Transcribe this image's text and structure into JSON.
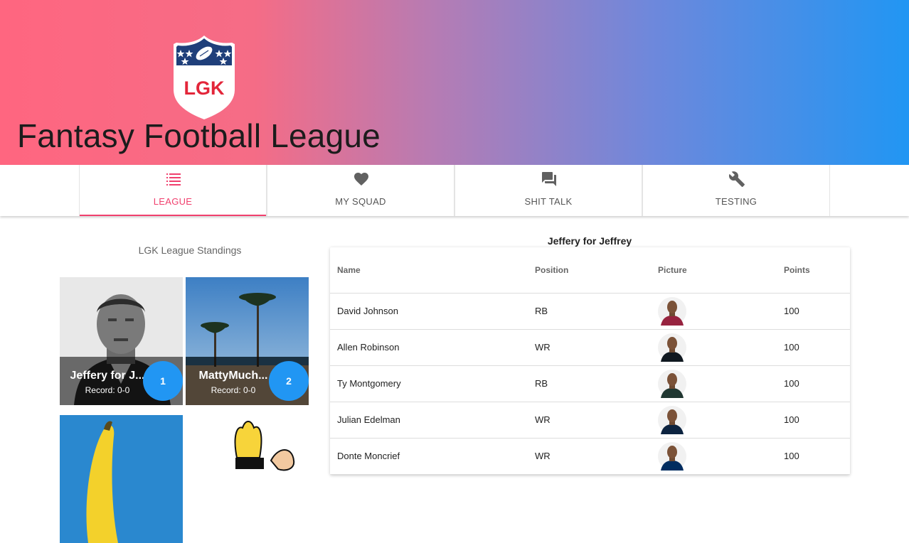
{
  "header": {
    "logo_text": "LGK",
    "title": "Fantasy Football League"
  },
  "tabs": [
    {
      "label": "LEAGUE",
      "icon": "list-icon",
      "active": true
    },
    {
      "label": "MY SQUAD",
      "icon": "heart-icon",
      "active": false
    },
    {
      "label": "SHIT TALK",
      "icon": "chat-icon",
      "active": false
    },
    {
      "label": "TESTING",
      "icon": "wrench-icon",
      "active": false
    }
  ],
  "standings": {
    "title": "LGK League Standings",
    "teams": [
      {
        "name": "Jeffery for J...",
        "record": "Record: 0-0",
        "rank": "1"
      },
      {
        "name": "MattyMuch...",
        "record": "Record: 0-0",
        "rank": "2"
      }
    ]
  },
  "roster": {
    "title": "Jeffery for Jeffrey",
    "columns": [
      "Name",
      "Position",
      "Picture",
      "Points"
    ],
    "rows": [
      {
        "name": "David Johnson",
        "position": "RB",
        "points": "100",
        "jersey": "#97233f"
      },
      {
        "name": "Allen Robinson",
        "position": "WR",
        "points": "100",
        "jersey": "#101820"
      },
      {
        "name": "Ty Montgomery",
        "position": "RB",
        "points": "100",
        "jersey": "#203731"
      },
      {
        "name": "Julian Edelman",
        "position": "WR",
        "points": "100",
        "jersey": "#0c2340"
      },
      {
        "name": "Donte Moncrief",
        "position": "WR",
        "points": "100",
        "jersey": "#002c5f"
      }
    ]
  },
  "colors": {
    "accent": "#f0406e",
    "rank_badge": "#2196f3",
    "gradient_start": "#ff6680",
    "gradient_end": "#2196f3"
  }
}
